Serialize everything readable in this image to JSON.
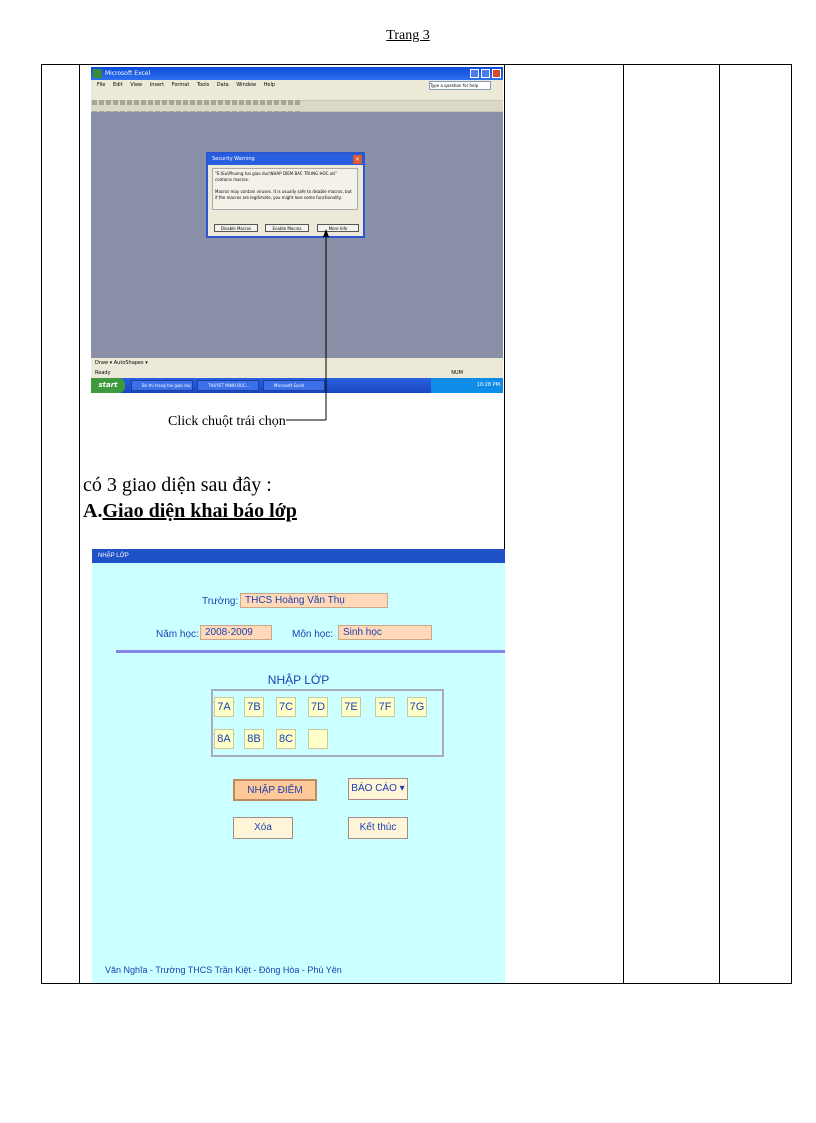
{
  "page": {
    "header": "Trang 3"
  },
  "excel_screenshot": {
    "title": "Microsoft Excel",
    "menu": [
      "File",
      "Edit",
      "View",
      "Insert",
      "Format",
      "Tools",
      "Data",
      "Window",
      "Help"
    ],
    "help_placeholder": "Type a question for help",
    "dialog": {
      "title": "Security Warning",
      "message1": "\"E:\\Eu\\Phuong hai giao duc\\NHAP DIEM BAC TRUNG HOC.xls\" contains macros.",
      "message2": "Macros may contain viruses. It is usually safe to disable macros, but if the macros are legitimate, you might lose some functionality.",
      "buttons": [
        "Disable Macros",
        "Enable Macros",
        "More Info"
      ]
    },
    "draw_bar": "Draw ▾   AutoShapes ▾",
    "status_left": "Ready",
    "status_right": "NUM",
    "taskbar": {
      "start": "start",
      "tasks": [
        "Bo thi trang hai giao duc",
        "THUYET MINH DOC...",
        "Microsoft Excel"
      ],
      "clock": "10:28 PM"
    }
  },
  "annotation": {
    "click_label": "Click  chuột  trái  chọn"
  },
  "text": {
    "intro": "có 3 giao diện sau đây :",
    "heading_prefix": "A.",
    "heading_title": "Giao diện khai báo lớp"
  },
  "form": {
    "title_bar": "NHẬP LỚP",
    "school_label": "Trường:",
    "school_value": "THCS Hoàng Văn Thụ",
    "year_label": "Năm học:",
    "year_value": "2008-2009",
    "subject_label": "Môn học:",
    "subject_value": "Sinh học",
    "section_title": "NHẬP LỚP",
    "classes_row1": [
      "7A",
      "7B",
      "7C",
      "7D",
      "7E",
      "7F",
      "7G"
    ],
    "classes_row2": [
      "8A",
      "8B",
      "8C",
      ""
    ],
    "buttons": {
      "enter_scores": "NHẬP ĐIỂM",
      "report": "BÁO CÁO",
      "delete": "Xóa",
      "finish": "Kết thúc"
    },
    "footer": "Văn Nghĩa - Trường THCS Trần Kiệt - Đông Hòa - Phú Yên"
  }
}
